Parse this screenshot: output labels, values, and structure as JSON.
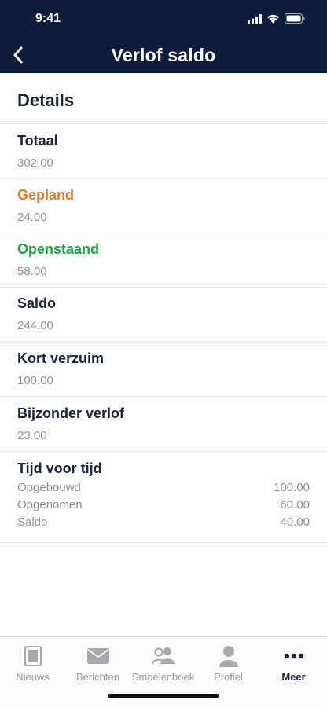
{
  "status": {
    "time": "9:41"
  },
  "nav": {
    "title": "Verlof saldo"
  },
  "section": {
    "title": "Details"
  },
  "rows": [
    {
      "label": "Totaal",
      "value": "302.00"
    },
    {
      "label": "Gepland",
      "value": "24.00"
    },
    {
      "label": "Openstaand",
      "value": "58.00"
    },
    {
      "label": "Saldo",
      "value": "244.00"
    },
    {
      "label": "Kort verzuim",
      "value": "100.00"
    },
    {
      "label": "Bijzonder verlof",
      "value": "23.00"
    }
  ],
  "tijd_voor_tijd": {
    "label": "Tijd voor tijd",
    "items": [
      {
        "key": "Opgebouwd",
        "value": "100.00"
      },
      {
        "key": "Opgenomen",
        "value": "60.00"
      },
      {
        "key": "Saldo",
        "value": "40.00"
      }
    ]
  },
  "tabs": [
    {
      "label": "Nieuws",
      "icon": "newspaper-icon"
    },
    {
      "label": "Berichten",
      "icon": "envelope-icon"
    },
    {
      "label": "Smoelenboek",
      "icon": "people-icon"
    },
    {
      "label": "Profiel",
      "icon": "person-icon"
    },
    {
      "label": "Meer",
      "icon": "more-dots-icon",
      "active": true
    }
  ],
  "colors": {
    "header": "#0f1c3a",
    "gepland": "#e07b35",
    "openstaand": "#1fa34a",
    "text": "#1b2336",
    "muted": "#8f8f94"
  }
}
